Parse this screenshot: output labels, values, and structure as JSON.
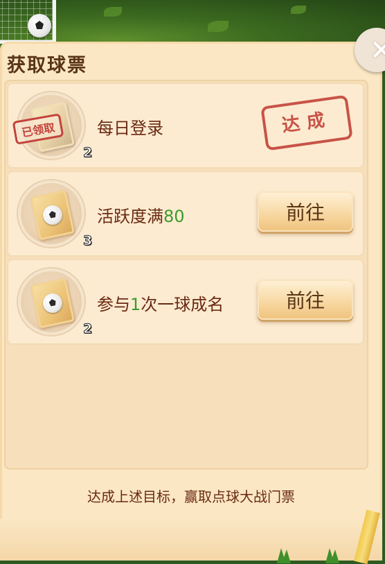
{
  "dialog": {
    "title": "获取球票",
    "close_label": "✕"
  },
  "tasks": [
    {
      "text": "每日登录",
      "highlight": "",
      "suffix": "",
      "reward_count": "2",
      "claimed_label": "已领取",
      "status": "达成"
    },
    {
      "text": "活跃度满",
      "highlight": "80",
      "suffix": "",
      "reward_count": "3",
      "button_label": "前往"
    },
    {
      "text": "参与",
      "highlight": "1",
      "suffix": "次一球成名",
      "reward_count": "2",
      "button_label": "前往"
    }
  ],
  "footer_text": "达成上述目标，赢取点球大战门票",
  "colors": {
    "panel": "#fbe7c4",
    "text_brown": "#6a2a12",
    "highlight_green": "#3d9a2c",
    "stamp_red": "#c3433a"
  }
}
